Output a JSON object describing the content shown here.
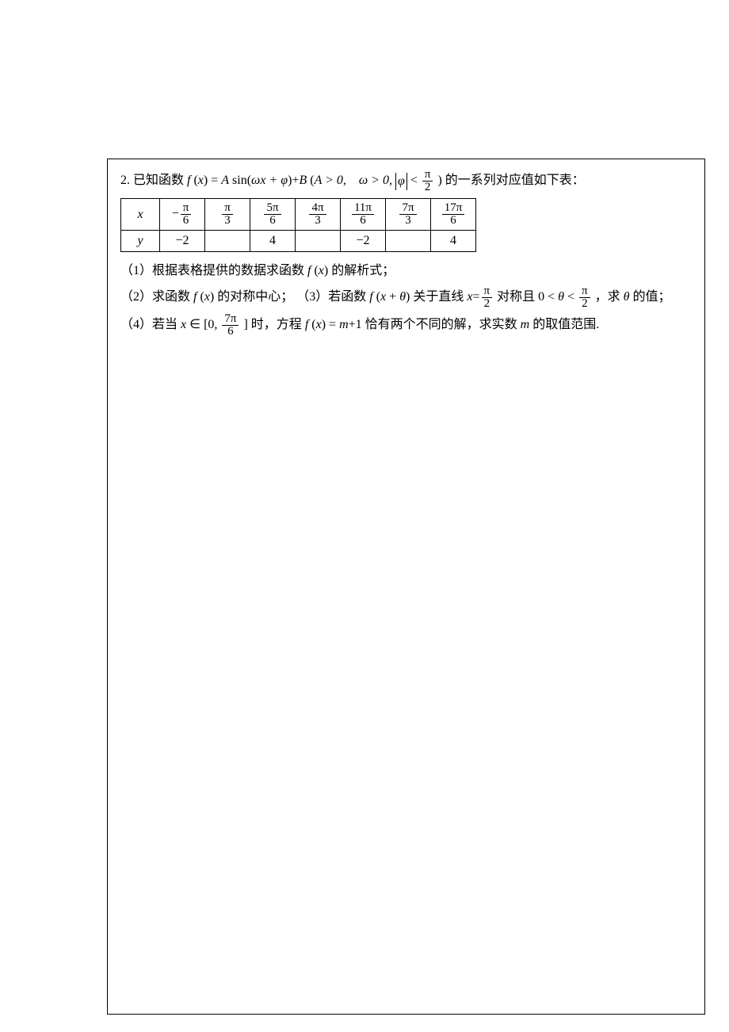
{
  "problem": {
    "number": "2.",
    "intro_a": "已知函数 ",
    "fx": "f",
    "fx_arg": "x",
    "eq": " = ",
    "A": "A",
    "sin": " sin(",
    "omega": "ω",
    "xplus": "x + ",
    "phi": "φ",
    "close": ")+",
    "B": "B",
    "cond_open": "(",
    "condA": "A > 0,　",
    "condW": "ω > 0, ",
    "phi_abs": "φ",
    "lt": " < ",
    "pi": "π",
    "two": "2",
    "cond_close": ")",
    "intro_b": "的一系列对应值如下表："
  },
  "table": {
    "row_x_label": "x",
    "row_y_label": "y",
    "x": [
      {
        "neg": "−",
        "num": "π",
        "den": "6"
      },
      {
        "num": "π",
        "den": "3"
      },
      {
        "num": "5π",
        "den": "6"
      },
      {
        "num": "4π",
        "den": "3"
      },
      {
        "num": "11π",
        "den": "6"
      },
      {
        "num": "7π",
        "den": "3"
      },
      {
        "num": "17π",
        "den": "6"
      }
    ],
    "y": [
      "−2",
      "",
      "4",
      "",
      "−2",
      "",
      "4"
    ]
  },
  "q1": "（1）根据表格提供的数据求函数 f (x) 的解析式；",
  "q2a": "（2）求函数 f (x) 的对称中心；",
  "q3a": "（3）若函数 f (x + θ) 关于直线 x=",
  "q3b": " 对称且 0 < θ < ",
  "q3c": " ，求 θ 的值；",
  "q4a": "（4）若当 x ∈ [0, ",
  "q4_num": "7π",
  "q4_den": "6",
  "q4b": "] 时，方程 f (x) = m+1 恰有两个不同的解，求实数 m 的取值范围.",
  "chart_data": {
    "type": "table",
    "columns_x": [
      "-π/6",
      "π/3",
      "5π/6",
      "4π/3",
      "11π/6",
      "7π/3",
      "17π/6"
    ],
    "columns_y": [
      -2,
      null,
      4,
      null,
      -2,
      null,
      4
    ]
  }
}
